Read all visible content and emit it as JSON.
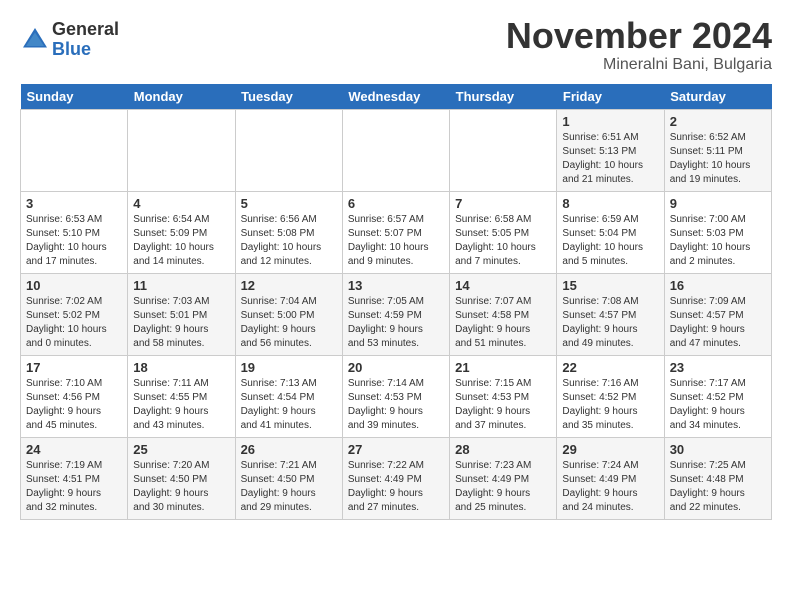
{
  "header": {
    "logo_general": "General",
    "logo_blue": "Blue",
    "month_title": "November 2024",
    "location": "Mineralni Bani, Bulgaria"
  },
  "calendar": {
    "headers": [
      "Sunday",
      "Monday",
      "Tuesday",
      "Wednesday",
      "Thursday",
      "Friday",
      "Saturday"
    ],
    "weeks": [
      {
        "days": [
          {
            "num": "",
            "info": ""
          },
          {
            "num": "",
            "info": ""
          },
          {
            "num": "",
            "info": ""
          },
          {
            "num": "",
            "info": ""
          },
          {
            "num": "",
            "info": ""
          },
          {
            "num": "1",
            "info": "Sunrise: 6:51 AM\nSunset: 5:13 PM\nDaylight: 10 hours\nand 21 minutes."
          },
          {
            "num": "2",
            "info": "Sunrise: 6:52 AM\nSunset: 5:11 PM\nDaylight: 10 hours\nand 19 minutes."
          }
        ]
      },
      {
        "days": [
          {
            "num": "3",
            "info": "Sunrise: 6:53 AM\nSunset: 5:10 PM\nDaylight: 10 hours\nand 17 minutes."
          },
          {
            "num": "4",
            "info": "Sunrise: 6:54 AM\nSunset: 5:09 PM\nDaylight: 10 hours\nand 14 minutes."
          },
          {
            "num": "5",
            "info": "Sunrise: 6:56 AM\nSunset: 5:08 PM\nDaylight: 10 hours\nand 12 minutes."
          },
          {
            "num": "6",
            "info": "Sunrise: 6:57 AM\nSunset: 5:07 PM\nDaylight: 10 hours\nand 9 minutes."
          },
          {
            "num": "7",
            "info": "Sunrise: 6:58 AM\nSunset: 5:05 PM\nDaylight: 10 hours\nand 7 minutes."
          },
          {
            "num": "8",
            "info": "Sunrise: 6:59 AM\nSunset: 5:04 PM\nDaylight: 10 hours\nand 5 minutes."
          },
          {
            "num": "9",
            "info": "Sunrise: 7:00 AM\nSunset: 5:03 PM\nDaylight: 10 hours\nand 2 minutes."
          }
        ]
      },
      {
        "days": [
          {
            "num": "10",
            "info": "Sunrise: 7:02 AM\nSunset: 5:02 PM\nDaylight: 10 hours\nand 0 minutes."
          },
          {
            "num": "11",
            "info": "Sunrise: 7:03 AM\nSunset: 5:01 PM\nDaylight: 9 hours\nand 58 minutes."
          },
          {
            "num": "12",
            "info": "Sunrise: 7:04 AM\nSunset: 5:00 PM\nDaylight: 9 hours\nand 56 minutes."
          },
          {
            "num": "13",
            "info": "Sunrise: 7:05 AM\nSunset: 4:59 PM\nDaylight: 9 hours\nand 53 minutes."
          },
          {
            "num": "14",
            "info": "Sunrise: 7:07 AM\nSunset: 4:58 PM\nDaylight: 9 hours\nand 51 minutes."
          },
          {
            "num": "15",
            "info": "Sunrise: 7:08 AM\nSunset: 4:57 PM\nDaylight: 9 hours\nand 49 minutes."
          },
          {
            "num": "16",
            "info": "Sunrise: 7:09 AM\nSunset: 4:57 PM\nDaylight: 9 hours\nand 47 minutes."
          }
        ]
      },
      {
        "days": [
          {
            "num": "17",
            "info": "Sunrise: 7:10 AM\nSunset: 4:56 PM\nDaylight: 9 hours\nand 45 minutes."
          },
          {
            "num": "18",
            "info": "Sunrise: 7:11 AM\nSunset: 4:55 PM\nDaylight: 9 hours\nand 43 minutes."
          },
          {
            "num": "19",
            "info": "Sunrise: 7:13 AM\nSunset: 4:54 PM\nDaylight: 9 hours\nand 41 minutes."
          },
          {
            "num": "20",
            "info": "Sunrise: 7:14 AM\nSunset: 4:53 PM\nDaylight: 9 hours\nand 39 minutes."
          },
          {
            "num": "21",
            "info": "Sunrise: 7:15 AM\nSunset: 4:53 PM\nDaylight: 9 hours\nand 37 minutes."
          },
          {
            "num": "22",
            "info": "Sunrise: 7:16 AM\nSunset: 4:52 PM\nDaylight: 9 hours\nand 35 minutes."
          },
          {
            "num": "23",
            "info": "Sunrise: 7:17 AM\nSunset: 4:52 PM\nDaylight: 9 hours\nand 34 minutes."
          }
        ]
      },
      {
        "days": [
          {
            "num": "24",
            "info": "Sunrise: 7:19 AM\nSunset: 4:51 PM\nDaylight: 9 hours\nand 32 minutes."
          },
          {
            "num": "25",
            "info": "Sunrise: 7:20 AM\nSunset: 4:50 PM\nDaylight: 9 hours\nand 30 minutes."
          },
          {
            "num": "26",
            "info": "Sunrise: 7:21 AM\nSunset: 4:50 PM\nDaylight: 9 hours\nand 29 minutes."
          },
          {
            "num": "27",
            "info": "Sunrise: 7:22 AM\nSunset: 4:49 PM\nDaylight: 9 hours\nand 27 minutes."
          },
          {
            "num": "28",
            "info": "Sunrise: 7:23 AM\nSunset: 4:49 PM\nDaylight: 9 hours\nand 25 minutes."
          },
          {
            "num": "29",
            "info": "Sunrise: 7:24 AM\nSunset: 4:49 PM\nDaylight: 9 hours\nand 24 minutes."
          },
          {
            "num": "30",
            "info": "Sunrise: 7:25 AM\nSunset: 4:48 PM\nDaylight: 9 hours\nand 22 minutes."
          }
        ]
      }
    ]
  }
}
